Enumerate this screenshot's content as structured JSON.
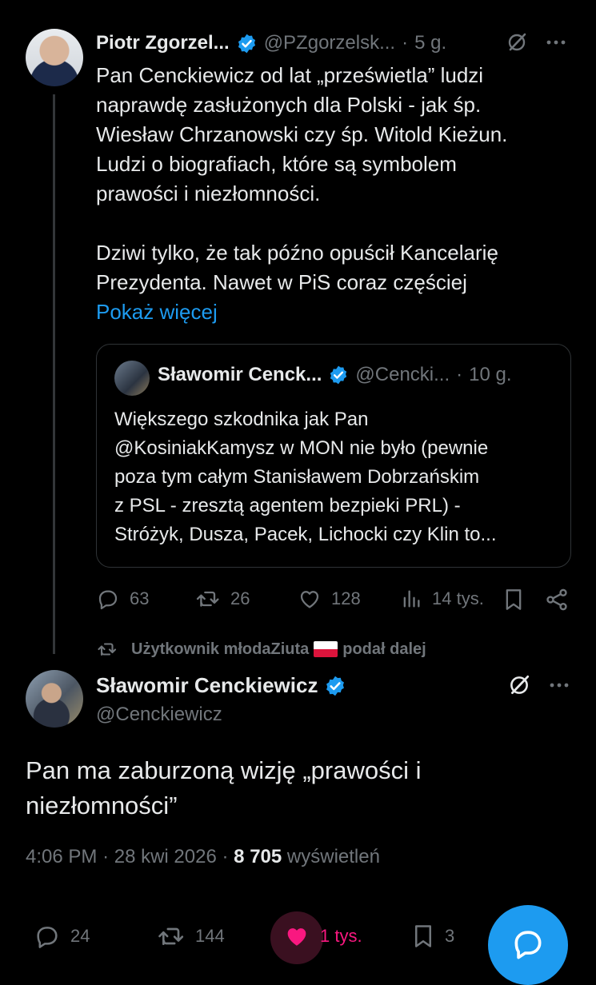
{
  "tweet1": {
    "author_name": "Piotr Zgorzel...",
    "handle": "@PZgorzelsk...",
    "time": "5 g.",
    "text_lines": [
      "Pan Cenckiewicz od lat „prześwietla” ludzi",
      "naprawdę zasłużonych dla Polski - jak śp.",
      "Wiesław Chrzanowski czy śp. Witold Kieżun.",
      "Ludzi o biografiach, które są symbolem",
      "prawości i niezłomności."
    ],
    "text_lines_2": [
      "Dziwi tylko, że tak późno opuścił Kancelarię",
      "Prezydenta. Nawet w PiS coraz częściej"
    ],
    "show_more": "Pokaż więcej",
    "quote": {
      "author_name": "Sławomir Cenck...",
      "handle": "@Cencki...",
      "time": "10 g.",
      "text_lines": [
        "Większego szkodnika jak Pan",
        "@KosiniakKamysz w MON nie było (pewnie",
        "poza tym całym Stanisławem Dobrzańskim",
        "z PSL - zresztą agentem bezpieki PRL) -",
        "Stróżyk, Dusza, Pacek, Lichocki czy Klin to..."
      ]
    },
    "actions": {
      "replies": "63",
      "reposts": "26",
      "likes": "128",
      "views": "14 tys."
    }
  },
  "repost_notice": {
    "prefix": "Użytkownik młodaZiuta",
    "suffix": "podał dalej"
  },
  "tweet2": {
    "author_name": "Sławomir Cenckiewicz",
    "handle": "@Cenckiewicz",
    "text_lines": [
      "Pan ma zaburzoną wizję „prawości i",
      "niezłomności”"
    ],
    "time": "4:06 PM",
    "date": "28 kwi 2026",
    "views_count": "8 705",
    "views_label": "wyświetleń",
    "actions": {
      "replies": "24",
      "reposts": "144",
      "likes": "1 tys.",
      "bookmarks": "3"
    }
  },
  "colors": {
    "accent": "#1d9bf0",
    "like": "#f91880",
    "muted": "#71767b",
    "text": "#e7e9ea",
    "background": "#000000"
  },
  "icons": [
    "verified-icon",
    "grok-icon",
    "more-icon",
    "reply-icon",
    "repost-icon",
    "like-icon",
    "views-icon",
    "bookmark-icon",
    "share-icon",
    "compose-icon"
  ]
}
